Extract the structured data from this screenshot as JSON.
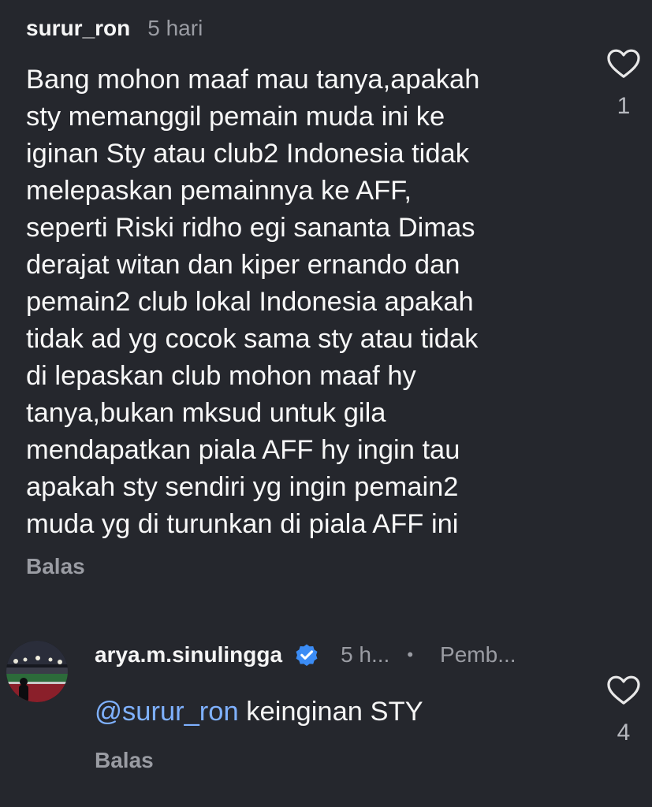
{
  "comment1": {
    "username": "surur_ron",
    "time": "5 hari",
    "lines": [
      "Bang mohon maaf mau tanya,apakah",
      "sty memanggil pemain muda ini ke",
      "iginan Sty atau club2 Indonesia tidak",
      "melepaskan pemainnya ke AFF,",
      "seperti Riski ridho egi sananta Dimas",
      "derajat witan dan kiper ernando dan",
      "pemain2 club lokal Indonesia apakah",
      "tidak ad yg cocok sama sty atau tidak",
      "di lepaskan club mohon maaf hy",
      "tanya,bukan mksud untuk gila",
      "mendapatkan piala AFF hy ingin tau",
      "apakah sty sendiri yg ingin pemain2",
      "muda yg di turunkan di piala AFF ini"
    ],
    "reply_label": "Balas",
    "like_count": "1",
    "like_icon": "heart-outline-icon"
  },
  "comment2": {
    "username": "arya.m.sinulingga",
    "verified_icon": "verified-badge-icon",
    "time": "5 h...",
    "separator": "•",
    "author_label": "Pemb...",
    "mention": "@surur_ron",
    "text": " keinginan STY",
    "reply_label": "Balas",
    "like_count": "4",
    "like_icon": "heart-outline-icon",
    "avatar_icon": "user-avatar"
  },
  "colors": {
    "background": "#25272d",
    "text": "#f5f5f5",
    "muted": "#9a9ca3",
    "mention": "#7fb1ff",
    "verified": "#3b8cf5"
  }
}
